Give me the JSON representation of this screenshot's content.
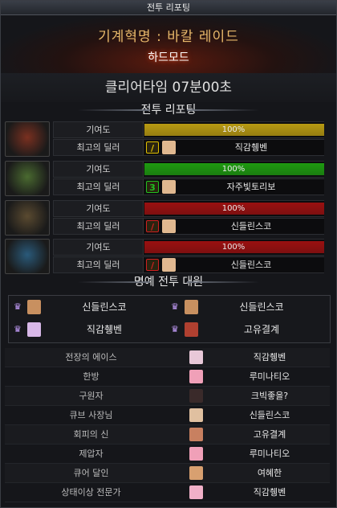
{
  "window": {
    "title": "전투 리포팅"
  },
  "raid": {
    "name": "기계혁명 : 바칼 레이드",
    "mode": "하드모드"
  },
  "clear_time": "클리어타임   07분00초",
  "sections": {
    "report": "전투 리포팅",
    "honor": "명예 전투 대원"
  },
  "parties": [
    {
      "contrib_label": "기여도",
      "contribution": "100%",
      "bar_color": "#b89a12",
      "dealer_label": "최고의 딜러",
      "job_glyph": "/",
      "job_color": "#e0c000",
      "dealer": "직감췡벤",
      "boss_color": "#7a3020"
    },
    {
      "contrib_label": "기여도",
      "contribution": "100%",
      "bar_color": "#1e9a10",
      "dealer_label": "최고의 딜러",
      "job_glyph": "3",
      "job_color": "#22c020",
      "dealer": "자주빛토리보",
      "boss_color": "#4a6a30"
    },
    {
      "contrib_label": "기여도",
      "contribution": "100%",
      "bar_color": "#9a1010",
      "dealer_label": "최고의 딜러",
      "job_glyph": "/",
      "job_color": "#d02020",
      "dealer": "신들린스코",
      "boss_color": "#5a4a30"
    },
    {
      "contrib_label": "기여도",
      "contribution": "100%",
      "bar_color": "#9a1010",
      "dealer_label": "최고의 딜러",
      "job_glyph": "/",
      "job_color": "#d02020",
      "dealer": "신들린스코",
      "boss_color": "#2a5a7a"
    }
  ],
  "honor_members": [
    "신들린스코",
    "신들린스코",
    "직감췡벤",
    "고유결계"
  ],
  "titles": [
    {
      "title": "전장의 에이스",
      "name": "직감췡벤"
    },
    {
      "title": "한방",
      "name": "루미나티오"
    },
    {
      "title": "구원자",
      "name": "크빅좋을?"
    },
    {
      "title": "큐브 사장님",
      "name": "신들린스코"
    },
    {
      "title": "회피의 신",
      "name": "고유결계"
    },
    {
      "title": "제압자",
      "name": "루미나티오"
    },
    {
      "title": "큐어 달인",
      "name": "여혜한"
    },
    {
      "title": "상태이상 전문가",
      "name": "직감췡벤"
    }
  ],
  "colors": {
    "accent_gold": "#e8b86a",
    "hardmode_glow": "#ff4a1a"
  },
  "icons": {
    "job": "job-icon",
    "portrait": "character-portrait",
    "crown": "crown-icon",
    "boss": "boss-portrait"
  }
}
